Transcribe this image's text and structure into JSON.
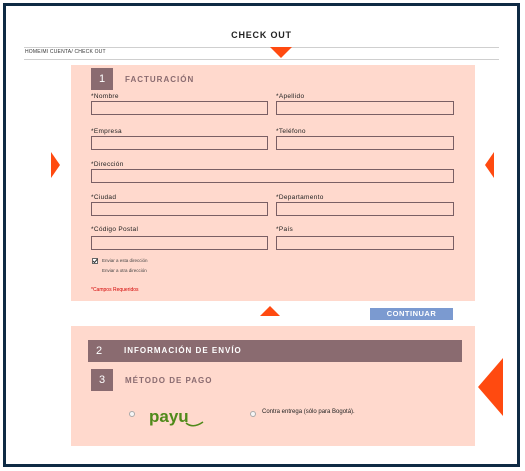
{
  "page": {
    "title": "CHECK OUT",
    "breadcrumb": "HOME/MI CUENTA/ CHECK OUT"
  },
  "billing": {
    "step_number": "1",
    "title": "FACTURACIÓN",
    "fields": {
      "nombre": "*Nombre",
      "apellido": "*Apellido",
      "empresa": "*Empresa",
      "telefono": "*Teléfono",
      "direccion": "*Dirección",
      "ciudad": "*Ciudad",
      "departamento": "*Departamento",
      "codigo_postal": "*Código Postal",
      "pais": "*País"
    },
    "ship_same_label": "Enviar a esta dirección",
    "ship_other_label": "Enviar a otra dirección",
    "required_note": "*Campos Requeridos",
    "continue_label": "CONTINUAR"
  },
  "shipping": {
    "step_number": "2",
    "title": "INFORMACIÓN DE ENVÍO"
  },
  "payment": {
    "step_number": "3",
    "title": "MÉTODO DE PAGO",
    "payu_logo": "payu",
    "cash_label": "Contra entrega (sólo para Bogotá)."
  },
  "colors": {
    "accent": "#ff4a10",
    "panel": "#ffd9cd",
    "step": "#8a6b70",
    "button": "#7b9ad0",
    "frame": "#0e2a44",
    "payu": "#a6c307"
  }
}
